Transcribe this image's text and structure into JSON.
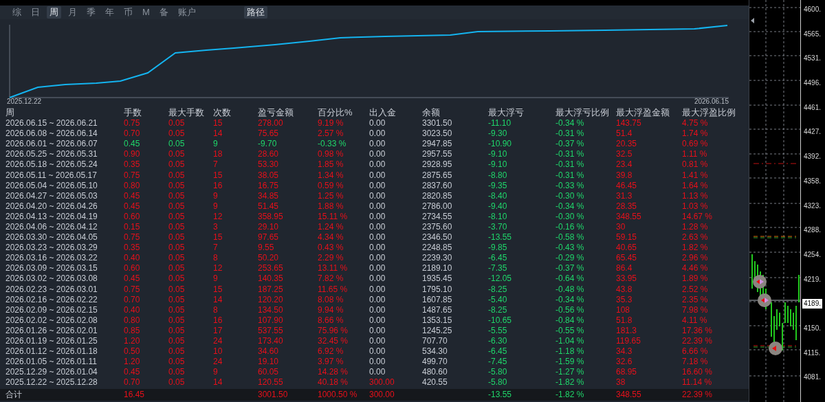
{
  "tabs": [
    {
      "label": "综",
      "selected": false
    },
    {
      "label": "日",
      "selected": false
    },
    {
      "label": "周",
      "selected": true
    },
    {
      "label": "月",
      "selected": false
    },
    {
      "label": "季",
      "selected": false
    },
    {
      "label": "年",
      "selected": false
    },
    {
      "label": "币",
      "selected": false
    },
    {
      "label": "M",
      "selected": false
    },
    {
      "label": "备",
      "selected": false
    },
    {
      "label": "账户",
      "selected": false
    }
  ],
  "path_button": "路径",
  "equity_chart": {
    "start_label": "2025.12.22",
    "end_label": "2026.06.15"
  },
  "table": {
    "columns": [
      "周",
      "手数",
      "最大手数",
      "次数",
      "盈亏金额",
      "百分比%",
      "出入金",
      "余额",
      "最大浮亏",
      "最大浮亏比例",
      "最大浮盈金额",
      "最大浮盈比例"
    ],
    "rows": [
      {
        "cells": [
          "2026.06.15 ~ 2026.06.21",
          "0.75",
          "0.05",
          "15",
          "278.00",
          "9.19 %",
          "0.00",
          "3301.50",
          "-11.10",
          "-0.34 %",
          "143.75",
          "4.75 %"
        ],
        "loss": false,
        "deposit_flagged": false
      },
      {
        "cells": [
          "2026.06.08 ~ 2026.06.14",
          "0.70",
          "0.05",
          "14",
          "75.65",
          "2.57 %",
          "0.00",
          "3023.50",
          "-9.30",
          "-0.31 %",
          "51.4",
          "1.74 %"
        ],
        "loss": false,
        "deposit_flagged": false
      },
      {
        "cells": [
          "2026.06.01 ~ 2026.06.07",
          "0.45",
          "0.05",
          "9",
          "-9.70",
          "-0.33 %",
          "0.00",
          "2947.85",
          "-10.90",
          "-0.37 %",
          "20.35",
          "0.69 %"
        ],
        "loss": true,
        "deposit_flagged": false
      },
      {
        "cells": [
          "2026.05.25 ~ 2026.05.31",
          "0.90",
          "0.05",
          "18",
          "28.60",
          "0.98 %",
          "0.00",
          "2957.55",
          "-9.10",
          "-0.31 %",
          "32.5",
          "1.11 %"
        ],
        "loss": false,
        "deposit_flagged": false
      },
      {
        "cells": [
          "2026.05.18 ~ 2026.05.24",
          "0.35",
          "0.05",
          "7",
          "53.30",
          "1.85 %",
          "0.00",
          "2928.95",
          "-9.10",
          "-0.31 %",
          "23.4",
          "0.81 %"
        ],
        "loss": false,
        "deposit_flagged": false
      },
      {
        "cells": [
          "2026.05.11 ~ 2026.05.17",
          "0.75",
          "0.05",
          "15",
          "38.05",
          "1.34 %",
          "0.00",
          "2875.65",
          "-8.80",
          "-0.31 %",
          "39.8",
          "1.41 %"
        ],
        "loss": false,
        "deposit_flagged": false
      },
      {
        "cells": [
          "2026.05.04 ~ 2026.05.10",
          "0.80",
          "0.05",
          "16",
          "16.75",
          "0.59 %",
          "0.00",
          "2837.60",
          "-9.35",
          "-0.33 %",
          "46.45",
          "1.64 %"
        ],
        "loss": false,
        "deposit_flagged": false
      },
      {
        "cells": [
          "2026.04.27 ~ 2026.05.03",
          "0.45",
          "0.05",
          "9",
          "34.85",
          "1.25 %",
          "0.00",
          "2820.85",
          "-8.40",
          "-0.30 %",
          "31.3",
          "1.13 %"
        ],
        "loss": false,
        "deposit_flagged": false
      },
      {
        "cells": [
          "2026.04.20 ~ 2026.04.26",
          "0.45",
          "0.05",
          "9",
          "51.45",
          "1.88 %",
          "0.00",
          "2786.00",
          "-9.40",
          "-0.34 %",
          "28.35",
          "1.03 %"
        ],
        "loss": false,
        "deposit_flagged": false
      },
      {
        "cells": [
          "2026.04.13 ~ 2026.04.19",
          "0.60",
          "0.05",
          "12",
          "358.95",
          "15.11 %",
          "0.00",
          "2734.55",
          "-8.10",
          "-0.30 %",
          "348.55",
          "14.67 %"
        ],
        "loss": false,
        "deposit_flagged": false
      },
      {
        "cells": [
          "2026.04.06 ~ 2026.04.12",
          "0.15",
          "0.05",
          "3",
          "29.10",
          "1.24 %",
          "0.00",
          "2375.60",
          "-3.70",
          "-0.16 %",
          "30",
          "1.28 %"
        ],
        "loss": false,
        "deposit_flagged": false
      },
      {
        "cells": [
          "2026.03.30 ~ 2026.04.05",
          "0.75",
          "0.05",
          "15",
          "97.65",
          "4.34 %",
          "0.00",
          "2346.50",
          "-13.55",
          "-0.58 %",
          "59.15",
          "2.63 %"
        ],
        "loss": false,
        "deposit_flagged": false
      },
      {
        "cells": [
          "2026.03.23 ~ 2026.03.29",
          "0.35",
          "0.05",
          "7",
          "9.55",
          "0.43 %",
          "0.00",
          "2248.85",
          "-9.85",
          "-0.43 %",
          "40.65",
          "1.82 %"
        ],
        "loss": false,
        "deposit_flagged": false
      },
      {
        "cells": [
          "2026.03.16 ~ 2026.03.22",
          "0.40",
          "0.05",
          "8",
          "50.20",
          "2.29 %",
          "0.00",
          "2239.30",
          "-6.45",
          "-0.29 %",
          "65.45",
          "2.96 %"
        ],
        "loss": false,
        "deposit_flagged": false
      },
      {
        "cells": [
          "2026.03.09 ~ 2026.03.15",
          "0.60",
          "0.05",
          "12",
          "253.65",
          "13.11 %",
          "0.00",
          "2189.10",
          "-7.35",
          "-0.37 %",
          "86.4",
          "4.46 %"
        ],
        "loss": false,
        "deposit_flagged": false
      },
      {
        "cells": [
          "2026.03.02 ~ 2026.03.08",
          "0.45",
          "0.05",
          "9",
          "140.35",
          "7.82 %",
          "0.00",
          "1935.45",
          "-12.05",
          "-0.64 %",
          "33.95",
          "1.89 %"
        ],
        "loss": false,
        "deposit_flagged": false
      },
      {
        "cells": [
          "2026.02.23 ~ 2026.03.01",
          "0.75",
          "0.05",
          "15",
          "187.25",
          "11.65 %",
          "0.00",
          "1795.10",
          "-8.25",
          "-0.48 %",
          "43.8",
          "2.52 %"
        ],
        "loss": false,
        "deposit_flagged": false
      },
      {
        "cells": [
          "2026.02.16 ~ 2026.02.22",
          "0.70",
          "0.05",
          "14",
          "120.20",
          "8.08 %",
          "0.00",
          "1607.85",
          "-5.40",
          "-0.34 %",
          "35.3",
          "2.35 %"
        ],
        "loss": false,
        "deposit_flagged": false
      },
      {
        "cells": [
          "2026.02.09 ~ 2026.02.15",
          "0.40",
          "0.05",
          "8",
          "134.50",
          "9.94 %",
          "0.00",
          "1487.65",
          "-8.25",
          "-0.56 %",
          "108",
          "7.98 %"
        ],
        "loss": false,
        "deposit_flagged": false
      },
      {
        "cells": [
          "2026.02.02 ~ 2026.02.08",
          "0.80",
          "0.05",
          "16",
          "107.90",
          "8.66 %",
          "0.00",
          "1353.15",
          "-10.65",
          "-0.84 %",
          "51.8",
          "4.11 %"
        ],
        "loss": false,
        "deposit_flagged": false
      },
      {
        "cells": [
          "2026.01.26 ~ 2026.02.01",
          "0.85",
          "0.05",
          "17",
          "537.55",
          "75.96 %",
          "0.00",
          "1245.25",
          "-5.55",
          "-0.55 %",
          "181.3",
          "17.36 %"
        ],
        "loss": false,
        "deposit_flagged": false
      },
      {
        "cells": [
          "2026.01.19 ~ 2026.01.25",
          "1.20",
          "0.05",
          "24",
          "173.40",
          "32.45 %",
          "0.00",
          "707.70",
          "-6.30",
          "-1.04 %",
          "119.65",
          "22.39 %"
        ],
        "loss": false,
        "deposit_flagged": false
      },
      {
        "cells": [
          "2026.01.12 ~ 2026.01.18",
          "0.50",
          "0.05",
          "10",
          "34.60",
          "6.92 %",
          "0.00",
          "534.30",
          "-6.45",
          "-1.18 %",
          "34.3",
          "6.66 %"
        ],
        "loss": false,
        "deposit_flagged": false
      },
      {
        "cells": [
          "2026.01.05 ~ 2026.01.11",
          "1.20",
          "0.05",
          "24",
          "19.10",
          "3.97 %",
          "0.00",
          "499.70",
          "-7.45",
          "-1.59 %",
          "32.6",
          "7.18 %"
        ],
        "loss": false,
        "deposit_flagged": false
      },
      {
        "cells": [
          "2025.12.29 ~ 2026.01.04",
          "0.45",
          "0.05",
          "9",
          "60.05",
          "14.28 %",
          "0.00",
          "480.60",
          "-5.80",
          "-1.27 %",
          "68.95",
          "16.60 %"
        ],
        "loss": false,
        "deposit_flagged": false
      },
      {
        "cells": [
          "2025.12.22 ~ 2025.12.28",
          "0.70",
          "0.05",
          "14",
          "120.55",
          "40.18 %",
          "300.00",
          "420.55",
          "-5.80",
          "-1.82 %",
          "38",
          "11.14 %"
        ],
        "loss": false,
        "deposit_flagged": true
      }
    ],
    "total": {
      "label": "合计",
      "lots": "16.45",
      "pnl": "3001.50",
      "pct": "1000.50 %",
      "deposit": "300.00",
      "max_dd": "-13.55",
      "max_dd_pct": "-1.82 %",
      "max_fp": "348.55",
      "max_fp_pct": "22.39 %"
    }
  },
  "price_axis": {
    "ticks": [
      {
        "label": "4600.",
        "current": false
      },
      {
        "label": "4565.",
        "current": false
      },
      {
        "label": "4531.",
        "current": false
      },
      {
        "label": "4496.",
        "current": false
      },
      {
        "label": "4461.",
        "current": false
      },
      {
        "label": "4427.",
        "current": false
      },
      {
        "label": "4392.",
        "current": false
      },
      {
        "label": "4358.",
        "current": false
      },
      {
        "label": "4323.",
        "current": false
      },
      {
        "label": "4288.",
        "current": false
      },
      {
        "label": "4254.",
        "current": false
      },
      {
        "label": "4219.",
        "current": false
      },
      {
        "label": "4189.",
        "current": true
      },
      {
        "label": "4150.",
        "current": false
      },
      {
        "label": "4115.",
        "current": false
      },
      {
        "label": "4081.",
        "current": false
      }
    ]
  }
}
